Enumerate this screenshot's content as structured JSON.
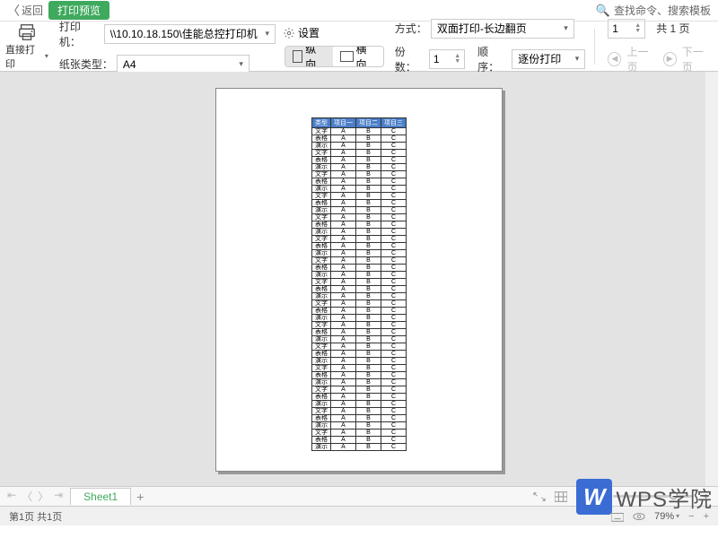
{
  "topbar": {
    "back": "返回",
    "title": "打印预览",
    "search": "查找命令、搜索模板"
  },
  "toolbar": {
    "direct_print": "直接打印",
    "printer_label": "打印机：",
    "printer_value": "\\\\10.10.18.150\\佳能总控打印机",
    "paper_label": "纸张类型：",
    "paper_value": "A4",
    "settings": "设置",
    "portrait": "纵向",
    "landscape": "横向",
    "mode_label": "方式：",
    "mode_value": "双面打印-长边翻页",
    "copies_label": "份数：",
    "copies_value": "1",
    "order_label": "顺序：",
    "order_value": "逐份打印",
    "page_input": "1",
    "page_total": "共 1 页",
    "prev_page": "上一页",
    "next_page": "下一页"
  },
  "table": {
    "headers": [
      "类型",
      "项目一",
      "项目二",
      "项目三"
    ],
    "type_cycle": [
      "文字",
      "表格",
      "演示"
    ],
    "rowvals": [
      "A",
      "B",
      "C"
    ],
    "rows": 45
  },
  "sheetbar": {
    "sheet": "Sheet1",
    "zoom": "79%"
  },
  "statusbar": {
    "page": "第1页 共1页",
    "zoom": "79%"
  },
  "watermark": "WPS学院"
}
